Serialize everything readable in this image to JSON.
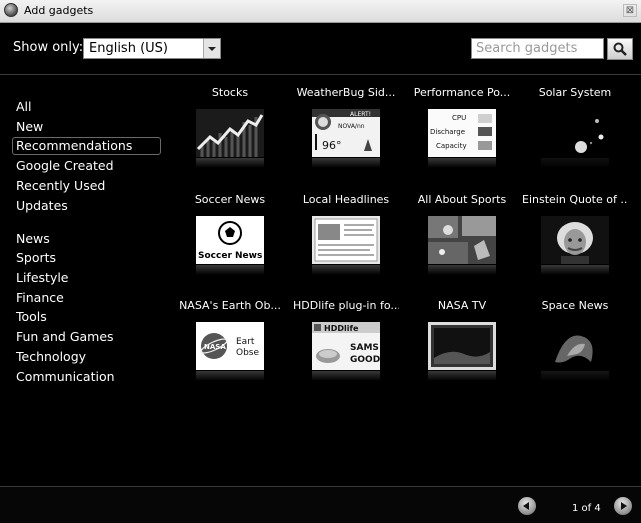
{
  "window": {
    "title": "Add gadgets",
    "close_label": "⊠"
  },
  "filter": {
    "label": "Show only:",
    "selected": "English (US)"
  },
  "search": {
    "placeholder": "Search gadgets"
  },
  "categories": [
    "All",
    "New",
    "Recommendations",
    "Google Created",
    "Recently Used",
    "Updates",
    "News",
    "Sports",
    "Lifestyle",
    "Finance",
    "Tools",
    "Fun and Games",
    "Technology",
    "Communication"
  ],
  "selected_category": "Recommendations",
  "gadgets": [
    {
      "title": "Stocks",
      "icon": "stocks-chart-icon"
    },
    {
      "title": "WeatherBug Sid...",
      "icon": "weather-icon",
      "thumb": {
        "alert": "ALERT!",
        "place": "NOVA/nn",
        "temp": "96°"
      }
    },
    {
      "title": "Performance Po...",
      "icon": "performance-meter-icon",
      "thumb": {
        "rows": [
          "CPU",
          "Discharge",
          "Capacity"
        ]
      }
    },
    {
      "title": "Solar System",
      "icon": "planets-icon"
    },
    {
      "title": "Soccer News",
      "icon": "soccer-ball-icon",
      "thumb": {
        "text": "Soccer News"
      }
    },
    {
      "title": "Local Headlines",
      "icon": "newspaper-icon"
    },
    {
      "title": "All About Sports",
      "icon": "sports-photo-icon"
    },
    {
      "title": "Einstein Quote of ...",
      "icon": "portrait-icon"
    },
    {
      "title": "NASA's Earth Ob...",
      "icon": "nasa-logo-icon",
      "thumb": {
        "logo": "NASA",
        "line1": "Eart",
        "line2": "Obse"
      }
    },
    {
      "title": "HDDlife plug-in fo...",
      "icon": "hard-drive-icon",
      "thumb": {
        "header": "HDDlife",
        "line1": "SAMS",
        "line2": "GOOD"
      }
    },
    {
      "title": "NASA TV",
      "icon": "tv-screen-icon"
    },
    {
      "title": "Space News",
      "icon": "nebula-icon"
    }
  ],
  "footer": {
    "page_label": "1 of 4"
  }
}
